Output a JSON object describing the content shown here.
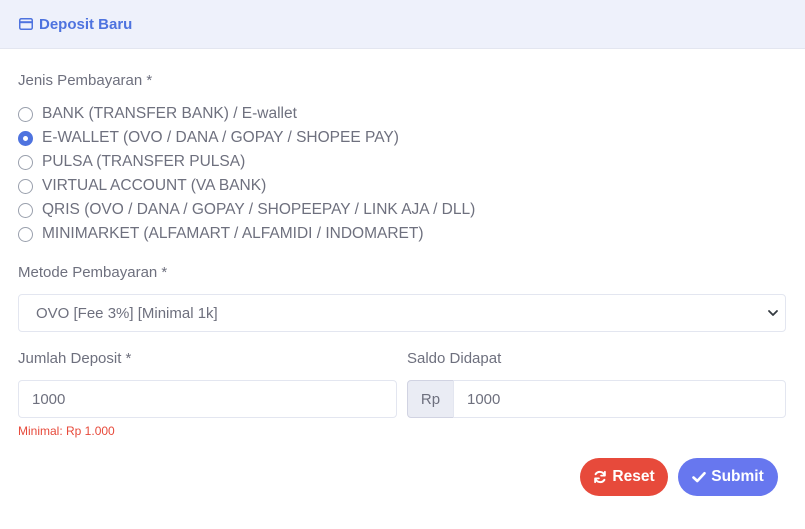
{
  "header": {
    "title": "Deposit Baru",
    "icon": "credit-card-icon"
  },
  "payment_type": {
    "label": "Jenis Pembayaran *",
    "options": [
      {
        "label": "BANK (TRANSFER BANK) / E-wallet",
        "checked": false
      },
      {
        "label": "E-WALLET (OVO / DANA / GOPAY / SHOPEE PAY)",
        "checked": true
      },
      {
        "label": "PULSA (TRANSFER PULSA)",
        "checked": false
      },
      {
        "label": "VIRTUAL ACCOUNT (VA BANK)",
        "checked": false
      },
      {
        "label": "QRIS (OVO / DANA / GOPAY / SHOPEEPAY / LINK AJA / DLL)",
        "checked": false
      },
      {
        "label": "MINIMARKET (ALFAMART / ALFAMIDI / INDOMARET)",
        "checked": false
      }
    ]
  },
  "payment_method": {
    "label": "Metode Pembayaran *",
    "selected": "OVO [Fee 3%] [Minimal 1k]"
  },
  "deposit_amount": {
    "label": "Jumlah Deposit *",
    "value": "1000",
    "hint": "Minimal: Rp 1.000"
  },
  "balance_received": {
    "label": "Saldo Didapat",
    "prefix": "Rp",
    "value": "1000"
  },
  "buttons": {
    "reset": "Reset",
    "submit": "Submit"
  },
  "colors": {
    "primary": "#4e73df",
    "danger": "#e74a3b",
    "submit": "#6777ef"
  }
}
